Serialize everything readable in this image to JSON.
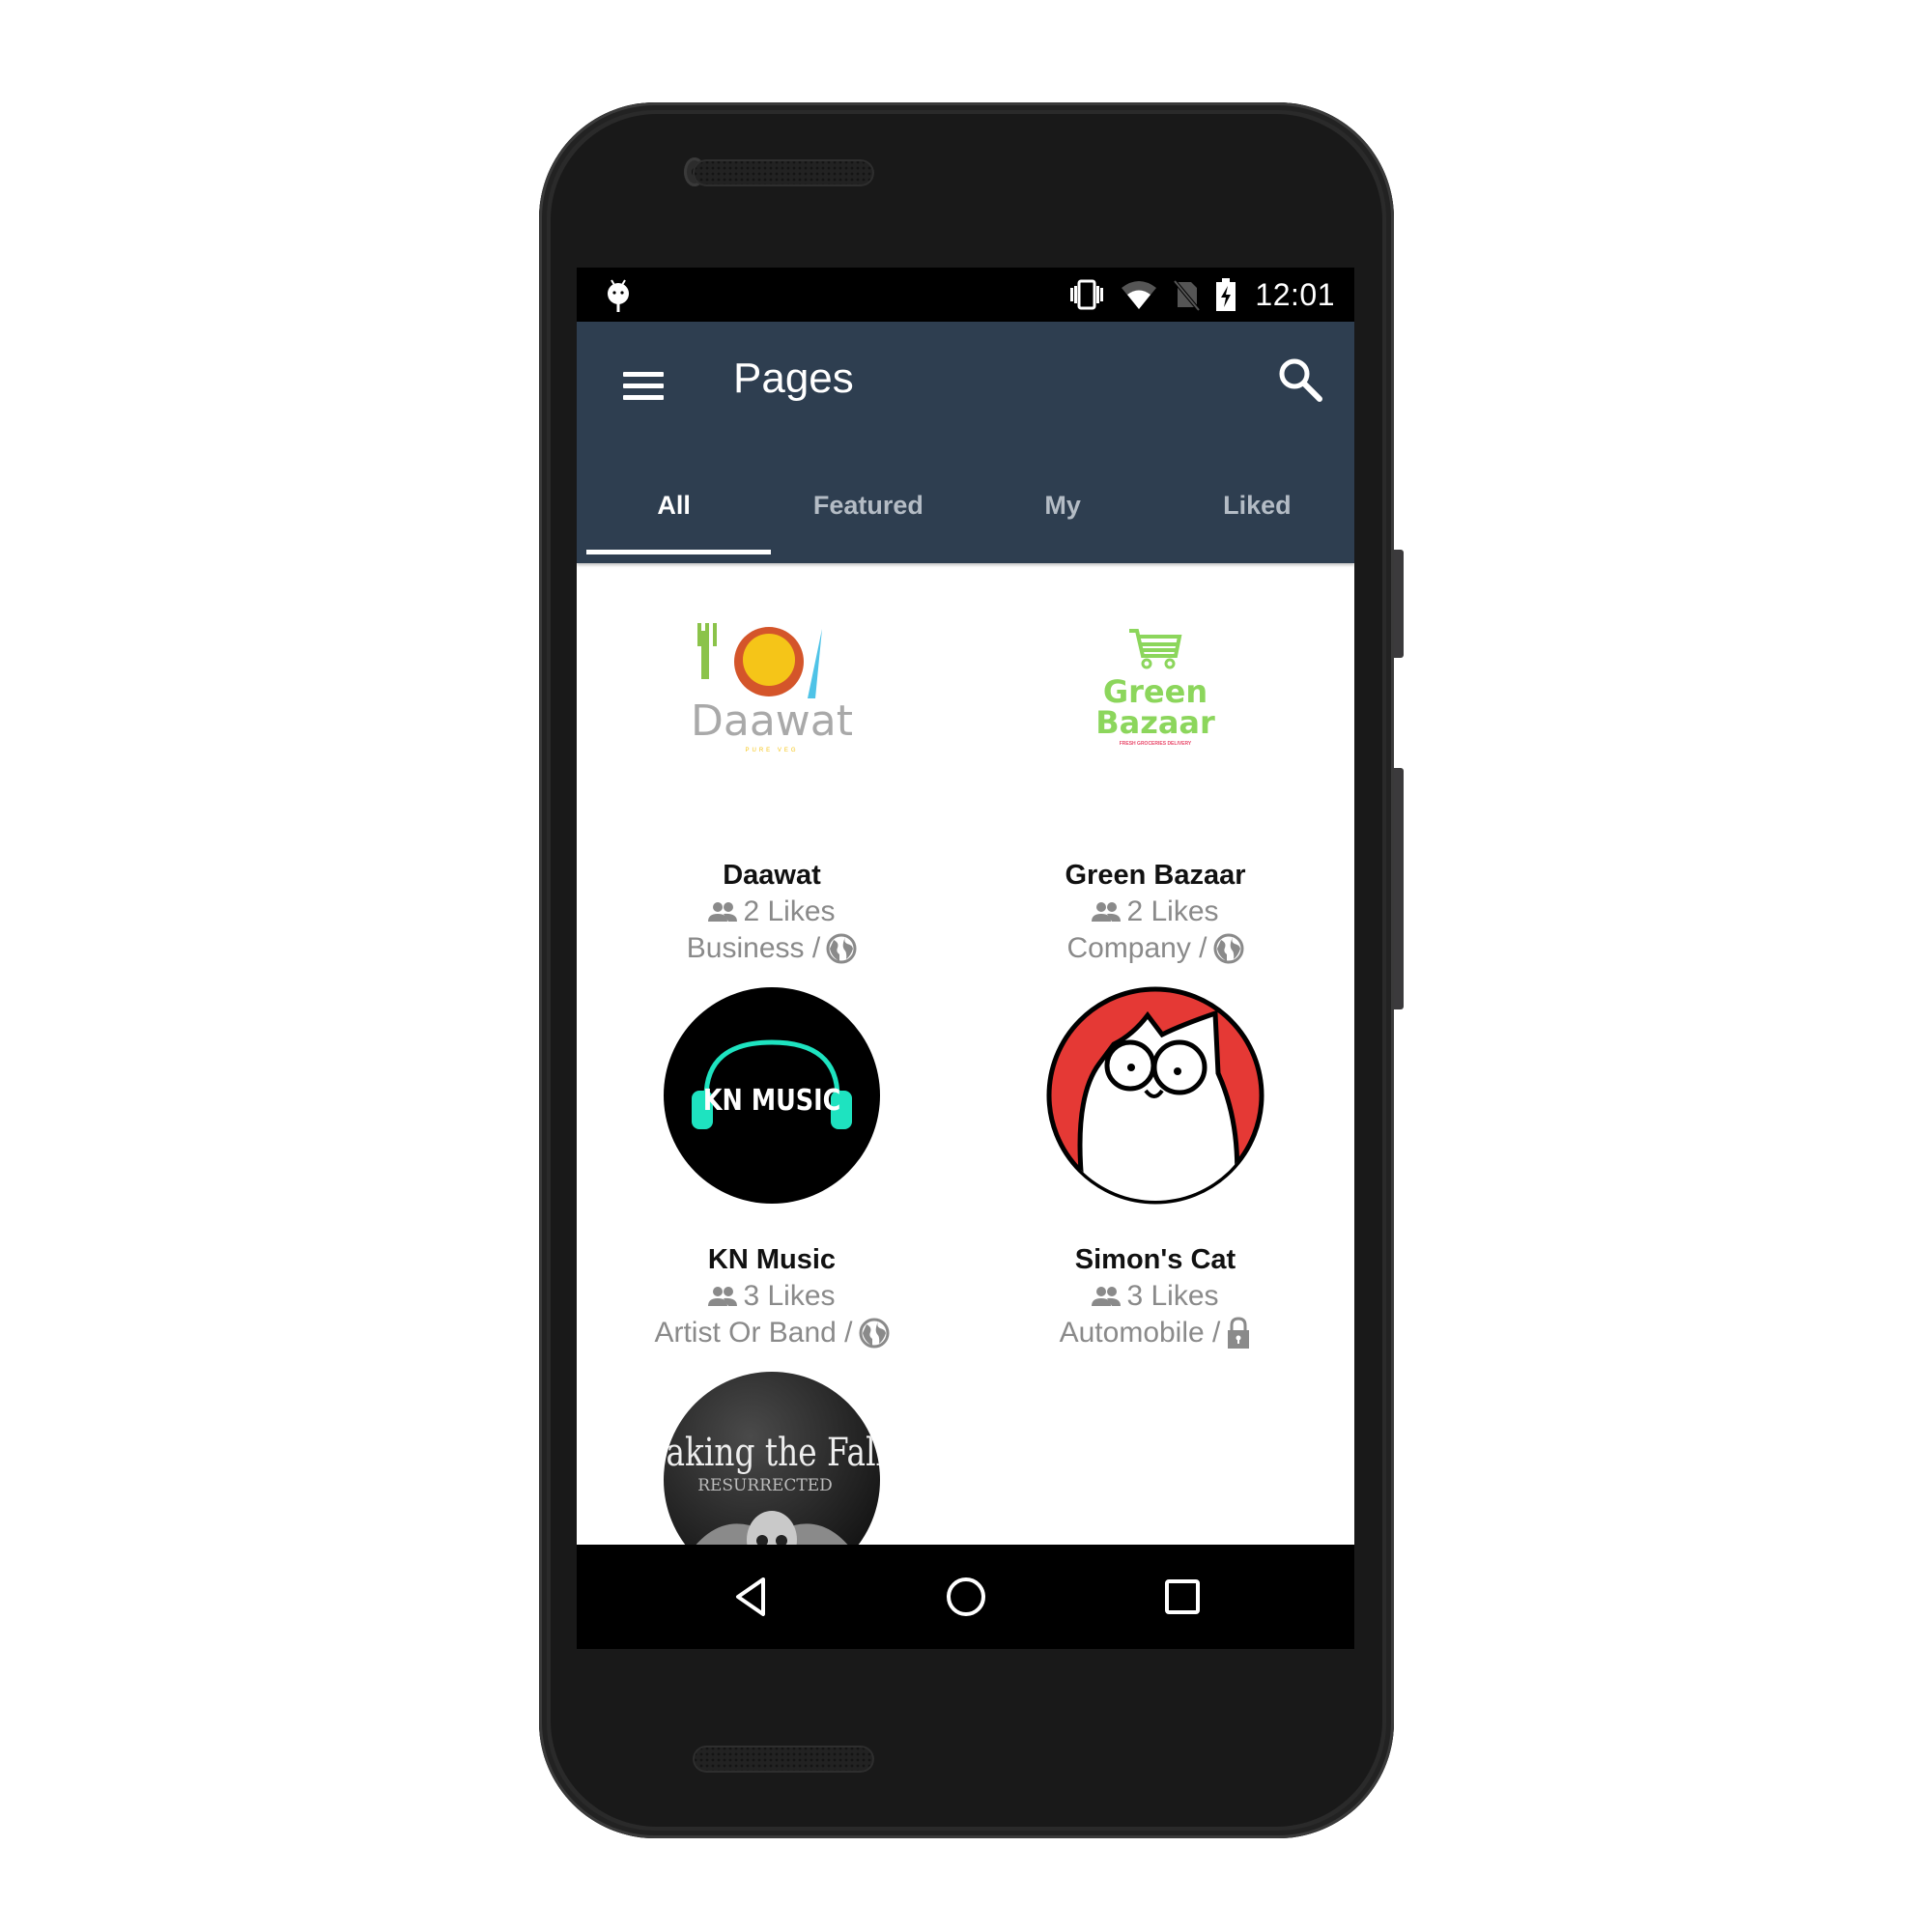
{
  "status_bar": {
    "time": "12:01",
    "icons": [
      "android-debug-icon",
      "vibrate-icon",
      "wifi-icon",
      "no-sim-icon",
      "battery-charging-icon"
    ]
  },
  "app_bar": {
    "title": "Pages",
    "menu_icon": "hamburger-menu-icon",
    "search_icon": "search-icon",
    "background_color": "#2e3e50"
  },
  "tabs": [
    {
      "label": "All",
      "active": true
    },
    {
      "label": "Featured",
      "active": false
    },
    {
      "label": "My",
      "active": false
    },
    {
      "label": "Liked",
      "active": false
    }
  ],
  "pages": [
    {
      "name": "Daawat",
      "likes": "2 Likes",
      "category": "Business /",
      "privacy_icon": "globe-icon",
      "logo_text": "Daawat",
      "logo_subtext": "PURE VEG"
    },
    {
      "name": "Green Bazaar",
      "likes": "2 Likes",
      "category": "Company /",
      "privacy_icon": "globe-icon",
      "logo_text_1": "Green",
      "logo_text_2": "Bazaar",
      "logo_subtext": "FRESH GROCERIES DELIVERY"
    },
    {
      "name": "KN Music",
      "likes": "3 Likes",
      "category": "Artist Or Band /",
      "privacy_icon": "globe-icon",
      "logo_text": "KN MUSIC"
    },
    {
      "name": "Simon's Cat",
      "likes": "3 Likes",
      "category": "Automobile /",
      "privacy_icon": "lock-icon"
    },
    {
      "logo_text": "aking the Fall",
      "logo_subtext": "RESURRECTED"
    }
  ],
  "nav_bar": {
    "back_icon": "back-triangle-icon",
    "home_icon": "home-circle-icon",
    "recents_icon": "recents-square-icon"
  }
}
